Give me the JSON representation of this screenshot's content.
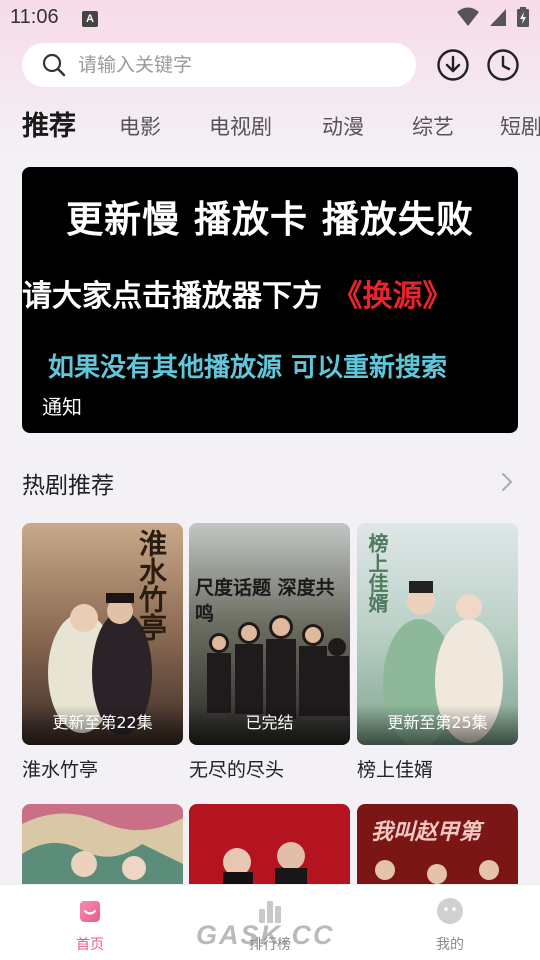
{
  "status_bar": {
    "time": "11:06",
    "notification_icon": "A"
  },
  "search": {
    "placeholder": "请输入关键字"
  },
  "tabs": [
    "推荐",
    "电影",
    "电视剧",
    "动漫",
    "综艺",
    "短剧"
  ],
  "banner": {
    "line1": "更新慢 播放卡 播放失败",
    "line2_prefix": "请大家点击播放器下方 ",
    "line2_highlight": "《换源》",
    "line3": "如果没有其他播放源 可以重新搜索",
    "notice": "通知"
  },
  "section": {
    "title": "热剧推荐"
  },
  "cards": [
    {
      "title": "淮水竹亭",
      "status": "更新至第22集",
      "poster_text": "淮水竹亭"
    },
    {
      "title": "无尽的尽头",
      "status": "已完结",
      "poster_text": "尺度话题 深度共鸣"
    },
    {
      "title": "榜上佳婿",
      "status": "更新至第25集",
      "poster_text": "榜上佳婿"
    }
  ],
  "row2_poster_text": "我叫赵甲第",
  "bottom_nav": [
    {
      "label": "首页",
      "icon": "home-icon"
    },
    {
      "label": "排行榜",
      "icon": "ranking-icon"
    },
    {
      "label": "我的",
      "icon": "profile-icon"
    }
  ],
  "watermark": "GASK.CC",
  "colors": {
    "accent": "#e75b8e",
    "banner_red": "#e8242c",
    "banner_cyan": "#5fc7d9"
  }
}
